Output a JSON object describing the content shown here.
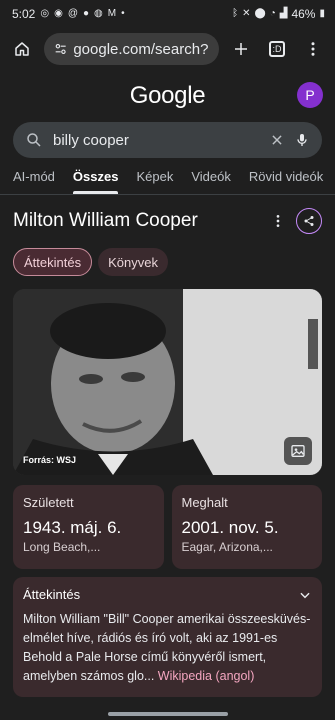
{
  "status_bar": {
    "time": "5:02",
    "battery": "46%",
    "left_icons": [
      "instagram-icon",
      "messenger-icon",
      "threads-icon",
      "reddit-icon",
      "facebook-icon",
      "gmail-icon",
      "dot-icon"
    ],
    "right_icons": [
      "bluetooth-icon",
      "mute-icon",
      "location-icon",
      "wifi-icon",
      "signal-icon",
      "battery-icon"
    ]
  },
  "browser": {
    "url": "google.com/search?c",
    "tab_count": ":D"
  },
  "google": {
    "logo": "Google",
    "avatar_letter": "P",
    "accent": "#8430ce"
  },
  "search": {
    "query": "billy cooper"
  },
  "tabs": [
    {
      "label": "AI-mód"
    },
    {
      "label": "Összes"
    },
    {
      "label": "Képek"
    },
    {
      "label": "Videók"
    },
    {
      "label": "Rövid videók"
    }
  ],
  "knowledge_panel": {
    "title": "Milton William Cooper",
    "chips": [
      {
        "label": "Áttekintés"
      },
      {
        "label": "Könyvek"
      }
    ],
    "photo_credit": "Forrás: WSJ",
    "born": {
      "label": "Született",
      "value": "1943. máj. 6.",
      "place": "Long Beach,..."
    },
    "died": {
      "label": "Meghalt",
      "value": "2001. nov. 5.",
      "place": "Eagar, Arizona,..."
    },
    "overview": {
      "title": "Áttekintés",
      "text": "Milton William \"Bill\" Cooper amerikai összeesküvés-elmélet híve, rádiós és író volt, aki az 1991-es Behold a Pale Horse című könyvéről ismert, amelyben számos glo...",
      "link": "Wikipedia (angol)"
    }
  }
}
